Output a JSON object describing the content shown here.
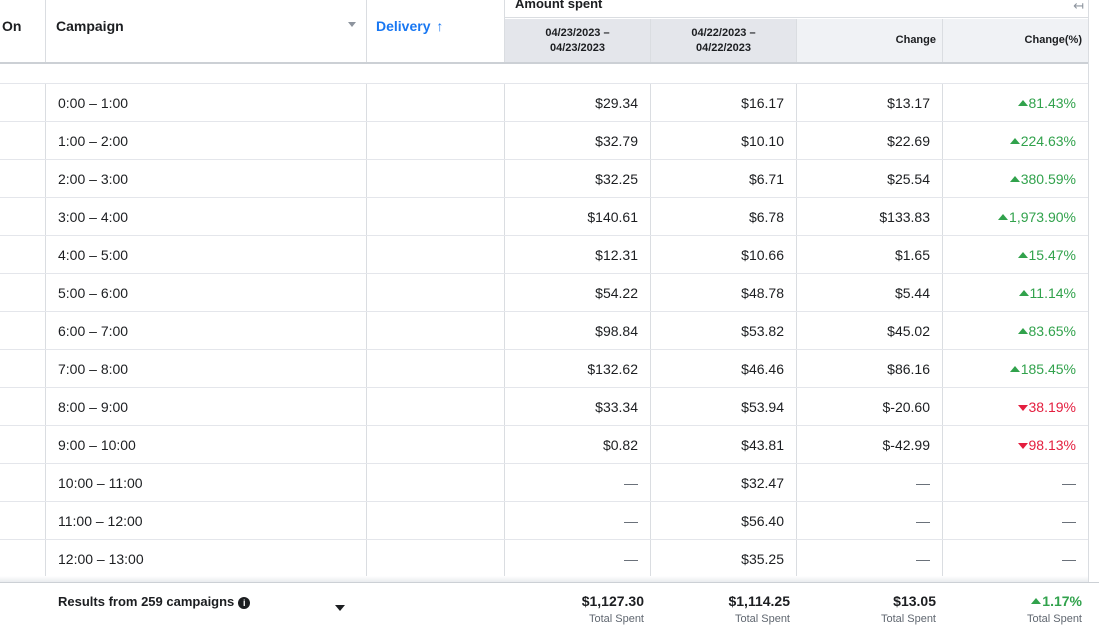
{
  "header": {
    "on": "On",
    "campaign": "Campaign",
    "delivery": "Delivery",
    "delivery_sort_arrow": "↑",
    "amount_spent": "Amount spent",
    "collapse_glyph": "↤",
    "date1_line1": "04/23/2023 –",
    "date1_line2": "04/23/2023",
    "date2_line1": "04/22/2023 –",
    "date2_line2": "04/22/2023",
    "change": "Change",
    "change_pct": "Change(%)"
  },
  "rows": [
    {
      "name": "0:00 – 1:00",
      "d1": "$29.34",
      "d2": "$16.17",
      "ch": "$13.17",
      "pct": "81.43%",
      "dir": "up"
    },
    {
      "name": "1:00 – 2:00",
      "d1": "$32.79",
      "d2": "$10.10",
      "ch": "$22.69",
      "pct": "224.63%",
      "dir": "up"
    },
    {
      "name": "2:00 – 3:00",
      "d1": "$32.25",
      "d2": "$6.71",
      "ch": "$25.54",
      "pct": "380.59%",
      "dir": "up"
    },
    {
      "name": "3:00 – 4:00",
      "d1": "$140.61",
      "d2": "$6.78",
      "ch": "$133.83",
      "pct": "1,973.90%",
      "dir": "up"
    },
    {
      "name": "4:00 – 5:00",
      "d1": "$12.31",
      "d2": "$10.66",
      "ch": "$1.65",
      "pct": "15.47%",
      "dir": "up"
    },
    {
      "name": "5:00 – 6:00",
      "d1": "$54.22",
      "d2": "$48.78",
      "ch": "$5.44",
      "pct": "11.14%",
      "dir": "up"
    },
    {
      "name": "6:00 – 7:00",
      "d1": "$98.84",
      "d2": "$53.82",
      "ch": "$45.02",
      "pct": "83.65%",
      "dir": "up"
    },
    {
      "name": "7:00 – 8:00",
      "d1": "$132.62",
      "d2": "$46.46",
      "ch": "$86.16",
      "pct": "185.45%",
      "dir": "up"
    },
    {
      "name": "8:00 – 9:00",
      "d1": "$33.34",
      "d2": "$53.94",
      "ch": "$-20.60",
      "pct": "38.19%",
      "dir": "down"
    },
    {
      "name": "9:00 – 10:00",
      "d1": "$0.82",
      "d2": "$43.81",
      "ch": "$-42.99",
      "pct": "98.13%",
      "dir": "down"
    },
    {
      "name": "10:00 – 11:00",
      "d1": "—",
      "d2": "$32.47",
      "ch": "—",
      "pct": "—",
      "dir": "none"
    },
    {
      "name": "11:00 – 12:00",
      "d1": "—",
      "d2": "$56.40",
      "ch": "—",
      "pct": "—",
      "dir": "none"
    },
    {
      "name": "12:00 – 13:00",
      "d1": "—",
      "d2": "$35.25",
      "ch": "—",
      "pct": "—",
      "dir": "none"
    }
  ],
  "footer": {
    "label": "Results from 259 campaigns",
    "info_glyph": "i",
    "d1": "$1,127.30",
    "d2": "$1,114.25",
    "ch": "$13.05",
    "pct": "1.17%",
    "sub": "Total Spent"
  },
  "colors": {
    "up": "#31a24c",
    "down": "#e41e3f",
    "link": "#1877f2"
  }
}
